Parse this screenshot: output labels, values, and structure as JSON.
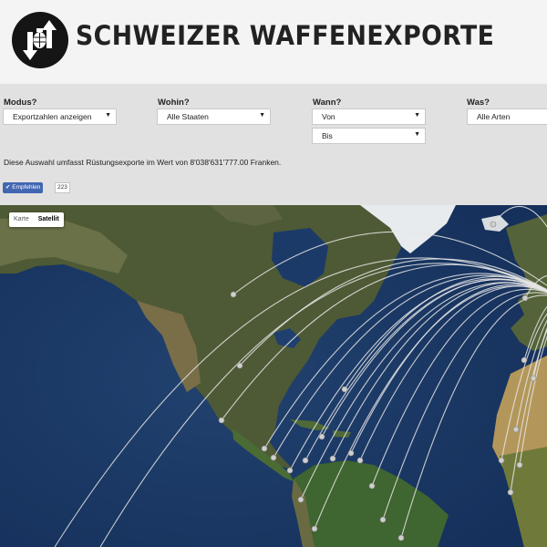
{
  "header": {
    "title": "SCHWEIZER WAFFENEXPORTE",
    "logo_icon": "grenade-arrows-icon"
  },
  "filters": {
    "mode": {
      "label": "Modus?",
      "value": "Exportzahlen anzeigen"
    },
    "where": {
      "label": "Wohin?",
      "value": "Alle Staaten"
    },
    "when": {
      "label": "Wann?",
      "from": "Von",
      "to": "Bis"
    },
    "what": {
      "label": "Was?",
      "value": "Alle Arten"
    }
  },
  "summary": "Diese Auswahl umfasst Rüstungsexporte im Wert von 8'038'631'777.00 Franken.",
  "social": {
    "like_label": "Empfehlen",
    "like_count": "223",
    "like_icon": "check-icon"
  },
  "map": {
    "type_control": [
      "Karte",
      "Satellit"
    ],
    "active_type": "Satellit",
    "colors": {
      "ocean": "#1b3765",
      "land": "#4f5b34",
      "ice": "#e8ecee",
      "desert": "#b79a5a",
      "arc": "#e6e6e6"
    }
  }
}
